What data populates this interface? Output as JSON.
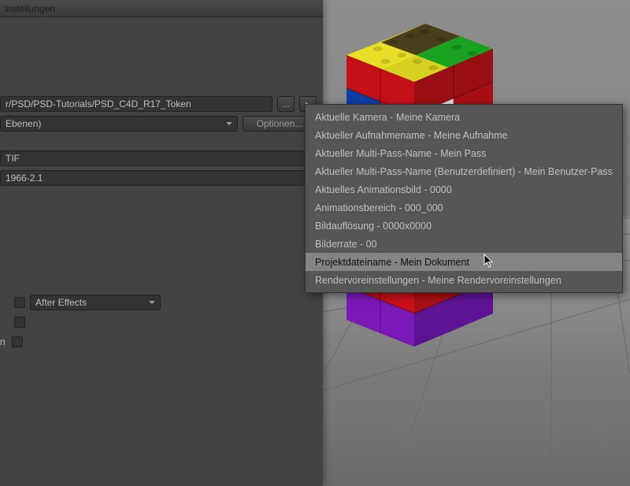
{
  "window": {
    "title": "instellungen"
  },
  "fields": {
    "path": "r/PSD/PSD-Tutorials/PSD_C4D_R17_Token",
    "layers": "Ebenen)",
    "format": "TIF",
    "colorspace": "1966-2.1",
    "compositing": "After Effects"
  },
  "buttons": {
    "browse": "...",
    "options": "Optionen...",
    "arrow": "▸"
  },
  "labels": {
    "row_n": "n"
  },
  "menu": {
    "items": [
      "Aktuelle Kamera - Meine Kamera",
      "Aktueller Aufnahmename - Meine Aufnahme",
      "Aktueller Multi-Pass-Name - Mein Pass",
      "Aktueller Multi-Pass-Name (Benutzerdefiniert) - Mein Benutzer-Pass",
      "Aktuelles Animationsbild - 0000",
      "Animationsbereich - 000_000",
      "Bildauflösung - 0000x0000",
      "Bilderrate - 00",
      "Projektdateiname - Mein Dokument",
      "Rendervoreinstellungen - Meine Rendervoreinstellungen"
    ],
    "highlighted_index": 8
  }
}
